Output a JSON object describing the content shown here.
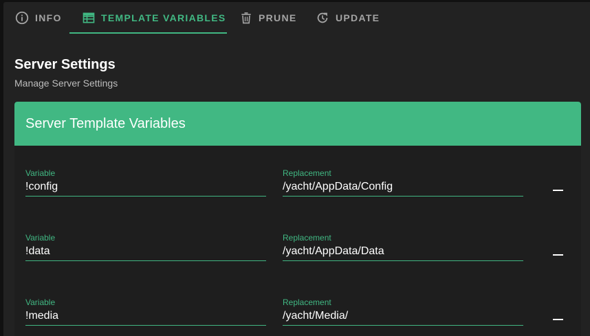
{
  "tabs": [
    {
      "label": "INFO",
      "icon": "info-circle-icon",
      "active": false
    },
    {
      "label": "TEMPLATE VARIABLES",
      "icon": "table-list-icon",
      "active": true
    },
    {
      "label": "PRUNE",
      "icon": "trash-icon",
      "active": false
    },
    {
      "label": "UPDATE",
      "icon": "update-refresh-icon",
      "active": false
    }
  ],
  "section": {
    "title": "Server Settings",
    "subtitle": "Manage Server Settings"
  },
  "card": {
    "title": "Server Template Variables"
  },
  "variables": [
    {
      "variable_label": "Variable",
      "variable": "!config",
      "replacement_label": "Replacement",
      "replacement": "/yacht/AppData/Config",
      "remove_icon": "minus-icon"
    },
    {
      "variable_label": "Variable",
      "variable": "!data",
      "replacement_label": "Replacement",
      "replacement": "/yacht/AppData/Data",
      "remove_icon": "minus-icon"
    },
    {
      "variable_label": "Variable",
      "variable": "!media",
      "replacement_label": "Replacement",
      "replacement": "/yacht/Media/",
      "remove_icon": "minus-icon"
    }
  ],
  "colors": {
    "accent": "#41b883",
    "background": "#222222",
    "card_background": "#1e1e1e",
    "tab_inactive": "#a4a4a4"
  }
}
